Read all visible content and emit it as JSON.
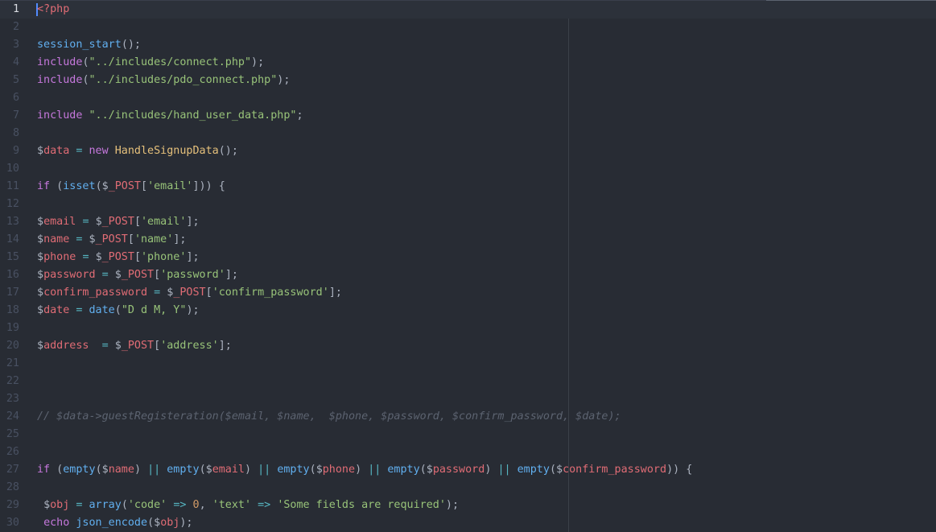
{
  "editor": {
    "language": "php",
    "cursor": {
      "line": 1,
      "column": 1
    },
    "colors": {
      "background": "#282c34",
      "gutter_text": "#495162",
      "cursor": "#528bff",
      "keyword": "#c678dd",
      "function": "#61afef",
      "string": "#98c379",
      "variable": "#e06c75",
      "class": "#e5c07b",
      "operator": "#56b6c2",
      "number": "#d19a66",
      "comment": "#5c6370"
    },
    "lines": [
      {
        "num": "1",
        "current": true,
        "tokens": [
          [
            "tag",
            "<?php"
          ]
        ]
      },
      {
        "num": "2",
        "tokens": []
      },
      {
        "num": "3",
        "tokens": [
          [
            "func",
            "session_start"
          ],
          [
            "punct",
            "();"
          ]
        ]
      },
      {
        "num": "4",
        "tokens": [
          [
            "keyword",
            "include"
          ],
          [
            "punct",
            "("
          ],
          [
            "string",
            "\"../includes/connect.php\""
          ],
          [
            "punct",
            ");"
          ]
        ]
      },
      {
        "num": "5",
        "tokens": [
          [
            "keyword",
            "include"
          ],
          [
            "punct",
            "("
          ],
          [
            "string",
            "\"../includes/pdo_connect.php\""
          ],
          [
            "punct",
            ");"
          ]
        ]
      },
      {
        "num": "6",
        "tokens": []
      },
      {
        "num": "7",
        "tokens": [
          [
            "keyword",
            "include"
          ],
          [
            "punct",
            " "
          ],
          [
            "string",
            "\"../includes/hand_user_data.php\""
          ],
          [
            "punct",
            ";"
          ]
        ]
      },
      {
        "num": "8",
        "tokens": []
      },
      {
        "num": "9",
        "tokens": [
          [
            "dollar",
            "$"
          ],
          [
            "var",
            "data"
          ],
          [
            "punct",
            " "
          ],
          [
            "op",
            "="
          ],
          [
            "punct",
            " "
          ],
          [
            "keyword",
            "new"
          ],
          [
            "punct",
            " "
          ],
          [
            "class",
            "HandleSignupData"
          ],
          [
            "punct",
            "();"
          ]
        ]
      },
      {
        "num": "10",
        "tokens": []
      },
      {
        "num": "11",
        "tokens": [
          [
            "keyword",
            "if"
          ],
          [
            "punct",
            " ("
          ],
          [
            "func",
            "isset"
          ],
          [
            "punct",
            "("
          ],
          [
            "dollar",
            "$"
          ],
          [
            "var",
            "_POST"
          ],
          [
            "punct",
            "["
          ],
          [
            "string",
            "'email'"
          ],
          [
            "punct",
            "])) {"
          ]
        ]
      },
      {
        "num": "12",
        "tokens": []
      },
      {
        "num": "13",
        "tokens": [
          [
            "dollar",
            "$"
          ],
          [
            "var",
            "email"
          ],
          [
            "punct",
            " "
          ],
          [
            "op",
            "="
          ],
          [
            "punct",
            " "
          ],
          [
            "dollar",
            "$"
          ],
          [
            "var",
            "_POST"
          ],
          [
            "punct",
            "["
          ],
          [
            "string",
            "'email'"
          ],
          [
            "punct",
            "];"
          ]
        ]
      },
      {
        "num": "14",
        "tokens": [
          [
            "dollar",
            "$"
          ],
          [
            "var",
            "name"
          ],
          [
            "punct",
            " "
          ],
          [
            "op",
            "="
          ],
          [
            "punct",
            " "
          ],
          [
            "dollar",
            "$"
          ],
          [
            "var",
            "_POST"
          ],
          [
            "punct",
            "["
          ],
          [
            "string",
            "'name'"
          ],
          [
            "punct",
            "];"
          ]
        ]
      },
      {
        "num": "15",
        "tokens": [
          [
            "dollar",
            "$"
          ],
          [
            "var",
            "phone"
          ],
          [
            "punct",
            " "
          ],
          [
            "op",
            "="
          ],
          [
            "punct",
            " "
          ],
          [
            "dollar",
            "$"
          ],
          [
            "var",
            "_POST"
          ],
          [
            "punct",
            "["
          ],
          [
            "string",
            "'phone'"
          ],
          [
            "punct",
            "];"
          ]
        ]
      },
      {
        "num": "16",
        "tokens": [
          [
            "dollar",
            "$"
          ],
          [
            "var",
            "password"
          ],
          [
            "punct",
            " "
          ],
          [
            "op",
            "="
          ],
          [
            "punct",
            " "
          ],
          [
            "dollar",
            "$"
          ],
          [
            "var",
            "_POST"
          ],
          [
            "punct",
            "["
          ],
          [
            "string",
            "'password'"
          ],
          [
            "punct",
            "];"
          ]
        ]
      },
      {
        "num": "17",
        "tokens": [
          [
            "dollar",
            "$"
          ],
          [
            "var",
            "confirm_password"
          ],
          [
            "punct",
            " "
          ],
          [
            "op",
            "="
          ],
          [
            "punct",
            " "
          ],
          [
            "dollar",
            "$"
          ],
          [
            "var",
            "_POST"
          ],
          [
            "punct",
            "["
          ],
          [
            "string",
            "'confirm_password'"
          ],
          [
            "punct",
            "];"
          ]
        ]
      },
      {
        "num": "18",
        "tokens": [
          [
            "dollar",
            "$"
          ],
          [
            "var",
            "date"
          ],
          [
            "punct",
            " "
          ],
          [
            "op",
            "="
          ],
          [
            "punct",
            " "
          ],
          [
            "func",
            "date"
          ],
          [
            "punct",
            "("
          ],
          [
            "string",
            "\"D d M, Y\""
          ],
          [
            "punct",
            ");"
          ]
        ]
      },
      {
        "num": "19",
        "tokens": []
      },
      {
        "num": "20",
        "tokens": [
          [
            "dollar",
            "$"
          ],
          [
            "var",
            "address"
          ],
          [
            "punct",
            "  "
          ],
          [
            "op",
            "="
          ],
          [
            "punct",
            " "
          ],
          [
            "dollar",
            "$"
          ],
          [
            "var",
            "_POST"
          ],
          [
            "punct",
            "["
          ],
          [
            "string",
            "'address'"
          ],
          [
            "punct",
            "];"
          ]
        ]
      },
      {
        "num": "21",
        "tokens": []
      },
      {
        "num": "22",
        "tokens": []
      },
      {
        "num": "23",
        "tokens": []
      },
      {
        "num": "24",
        "tokens": [
          [
            "comment",
            "// $data->guestRegisteration($email, $name,  $phone, $password, $confirm_password, $date);"
          ]
        ]
      },
      {
        "num": "25",
        "tokens": []
      },
      {
        "num": "26",
        "tokens": []
      },
      {
        "num": "27",
        "tokens": [
          [
            "keyword",
            "if"
          ],
          [
            "punct",
            " ("
          ],
          [
            "func",
            "empty"
          ],
          [
            "punct",
            "("
          ],
          [
            "dollar",
            "$"
          ],
          [
            "var",
            "name"
          ],
          [
            "punct",
            ") "
          ],
          [
            "op",
            "||"
          ],
          [
            "punct",
            " "
          ],
          [
            "func",
            "empty"
          ],
          [
            "punct",
            "("
          ],
          [
            "dollar",
            "$"
          ],
          [
            "var",
            "email"
          ],
          [
            "punct",
            ") "
          ],
          [
            "op",
            "||"
          ],
          [
            "punct",
            " "
          ],
          [
            "func",
            "empty"
          ],
          [
            "punct",
            "("
          ],
          [
            "dollar",
            "$"
          ],
          [
            "var",
            "phone"
          ],
          [
            "punct",
            ") "
          ],
          [
            "op",
            "||"
          ],
          [
            "punct",
            " "
          ],
          [
            "func",
            "empty"
          ],
          [
            "punct",
            "("
          ],
          [
            "dollar",
            "$"
          ],
          [
            "var",
            "password"
          ],
          [
            "punct",
            ") "
          ],
          [
            "op",
            "||"
          ],
          [
            "punct",
            " "
          ],
          [
            "func",
            "empty"
          ],
          [
            "punct",
            "("
          ],
          [
            "dollar",
            "$"
          ],
          [
            "var",
            "confirm_password"
          ],
          [
            "punct",
            ")) {"
          ]
        ]
      },
      {
        "num": "28",
        "tokens": []
      },
      {
        "num": "29",
        "tokens": [
          [
            "punct",
            " "
          ],
          [
            "dollar",
            "$"
          ],
          [
            "var",
            "obj"
          ],
          [
            "punct",
            " "
          ],
          [
            "op",
            "="
          ],
          [
            "punct",
            " "
          ],
          [
            "func",
            "array"
          ],
          [
            "punct",
            "("
          ],
          [
            "string",
            "'code'"
          ],
          [
            "punct",
            " "
          ],
          [
            "op",
            "=>"
          ],
          [
            "punct",
            " "
          ],
          [
            "number",
            "0"
          ],
          [
            "punct",
            ", "
          ],
          [
            "string",
            "'text'"
          ],
          [
            "punct",
            " "
          ],
          [
            "op",
            "=>"
          ],
          [
            "punct",
            " "
          ],
          [
            "string",
            "'Some fields are required'"
          ],
          [
            "punct",
            ");"
          ]
        ]
      },
      {
        "num": "30",
        "tokens": [
          [
            "punct",
            " "
          ],
          [
            "keyword",
            "echo"
          ],
          [
            "punct",
            " "
          ],
          [
            "func",
            "json_encode"
          ],
          [
            "punct",
            "("
          ],
          [
            "dollar",
            "$"
          ],
          [
            "var",
            "obj"
          ],
          [
            "punct",
            ");"
          ]
        ]
      }
    ]
  }
}
